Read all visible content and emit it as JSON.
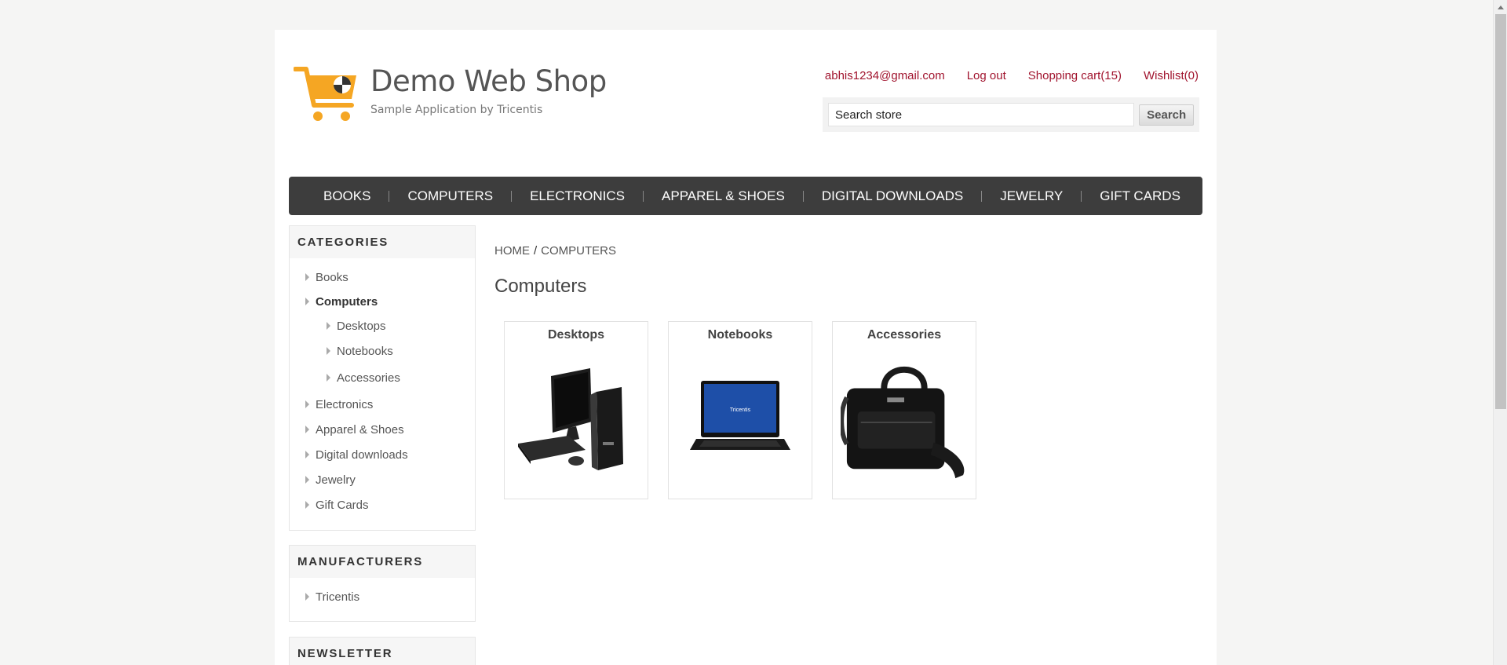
{
  "header": {
    "logo_title": "Demo Web Shop",
    "logo_subtitle": "Sample Application by Tricentis",
    "links": {
      "account": "abhis1234@gmail.com",
      "logout": "Log out",
      "cart": "Shopping cart(15)",
      "wishlist": "Wishlist(0)"
    },
    "search": {
      "value": "Search store",
      "button": "Search"
    }
  },
  "topmenu": [
    "BOOKS",
    "COMPUTERS",
    "ELECTRONICS",
    "APPAREL & SHOES",
    "DIGITAL DOWNLOADS",
    "JEWELRY",
    "GIFT CARDS"
  ],
  "sidebar": {
    "categories_title": "CATEGORIES",
    "categories": {
      "books": "Books",
      "computers": "Computers",
      "desktops": "Desktops",
      "notebooks": "Notebooks",
      "accessories": "Accessories",
      "electronics": "Electronics",
      "apparel": "Apparel & Shoes",
      "digital": "Digital downloads",
      "jewelry": "Jewelry",
      "gift": "Gift Cards"
    },
    "manufacturers_title": "MANUFACTURERS",
    "manufacturers": [
      "Tricentis"
    ],
    "newsletter_title": "NEWSLETTER"
  },
  "main": {
    "breadcrumb": {
      "home": "HOME",
      "separator": "/",
      "current": "COMPUTERS"
    },
    "title": "Computers",
    "subcategories": [
      "Desktops",
      "Notebooks",
      "Accessories"
    ],
    "laptop_screen_text": "Tricentis"
  },
  "colors": {
    "accent_link": "#a1142e",
    "menu_bg": "#3d3d3d",
    "logo_orange": "#f5a623"
  }
}
